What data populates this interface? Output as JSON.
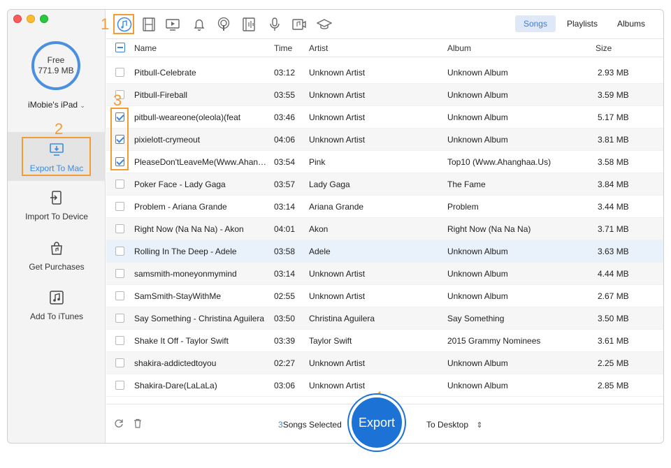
{
  "storage": {
    "label": "Free",
    "value": "771.9 MB"
  },
  "device": {
    "name": "iMobie's iPad"
  },
  "sidebar": {
    "items": [
      {
        "label": "Export To Mac"
      },
      {
        "label": "Import To Device"
      },
      {
        "label": "Get Purchases"
      },
      {
        "label": "Add To iTunes"
      }
    ]
  },
  "callouts": {
    "one": "1",
    "two": "2",
    "three": "3",
    "four": "4"
  },
  "tabs": {
    "songs": "Songs",
    "playlists": "Playlists",
    "albums": "Albums"
  },
  "columns": {
    "name": "Name",
    "time": "Time",
    "artist": "Artist",
    "album": "Album",
    "size": "Size"
  },
  "songs": [
    {
      "name": "Pitbull-Celebrate",
      "time": "03:12",
      "artist": "Unknown Artist",
      "album": "Unknown Album",
      "size": "2.93 MB",
      "checked": false
    },
    {
      "name": "Pitbull-Fireball",
      "time": "03:55",
      "artist": "Unknown Artist",
      "album": "Unknown Album",
      "size": "3.59 MB",
      "checked": false
    },
    {
      "name": "pitbull-weareone(oleola)(feat",
      "time": "03:46",
      "artist": "Unknown Artist",
      "album": "Unknown Album",
      "size": "5.17 MB",
      "checked": true
    },
    {
      "name": "pixielott-crymeout",
      "time": "04:06",
      "artist": "Unknown Artist",
      "album": "Unknown Album",
      "size": "3.81 MB",
      "checked": true
    },
    {
      "name": "PleaseDon'tLeaveMe(Www.Ahangha...",
      "time": "03:54",
      "artist": "Pink",
      "album": "Top10 (Www.Ahanghaa.Us)",
      "size": "3.58 MB",
      "checked": true
    },
    {
      "name": "Poker Face - Lady Gaga",
      "time": "03:57",
      "artist": "Lady Gaga",
      "album": "The Fame",
      "size": "3.84 MB",
      "checked": false
    },
    {
      "name": "Problem - Ariana Grande",
      "time": "03:14",
      "artist": "Ariana Grande",
      "album": "Problem",
      "size": "3.44 MB",
      "checked": false
    },
    {
      "name": "Right Now (Na Na Na) - Akon",
      "time": "04:01",
      "artist": "Akon",
      "album": "Right Now (Na Na Na)",
      "size": "3.71 MB",
      "checked": false
    },
    {
      "name": "Rolling In The Deep - Adele",
      "time": "03:58",
      "artist": "Adele",
      "album": "Unknown Album",
      "size": "3.63 MB",
      "checked": false
    },
    {
      "name": "samsmith-moneyonmymind",
      "time": "03:14",
      "artist": "Unknown Artist",
      "album": "Unknown Album",
      "size": "4.44 MB",
      "checked": false
    },
    {
      "name": "SamSmith-StayWithMe",
      "time": "02:55",
      "artist": "Unknown Artist",
      "album": "Unknown Album",
      "size": "2.67 MB",
      "checked": false
    },
    {
      "name": "Say Something - Christina Aguilera",
      "time": "03:50",
      "artist": "Christina Aguilera",
      "album": "Say Something",
      "size": "3.50 MB",
      "checked": false
    },
    {
      "name": "Shake It Off - Taylor Swift",
      "time": "03:39",
      "artist": "Taylor Swift",
      "album": "2015 Grammy Nominees",
      "size": "3.61 MB",
      "checked": false
    },
    {
      "name": "shakira-addictedtoyou",
      "time": "02:27",
      "artist": "Unknown Artist",
      "album": "Unknown Album",
      "size": "2.25 MB",
      "checked": false
    },
    {
      "name": "Shakira-Dare(LaLaLa)",
      "time": "03:06",
      "artist": "Unknown Artist",
      "album": "Unknown Album",
      "size": "2.85 MB",
      "checked": false
    }
  ],
  "footer": {
    "count": "3",
    "selected_label": "Songs Selected",
    "export_label": "Export",
    "destination": "To Desktop"
  },
  "colors": {
    "accent": "#3c8be5",
    "highlight": "#f39c33",
    "export": "#1d72d6"
  }
}
